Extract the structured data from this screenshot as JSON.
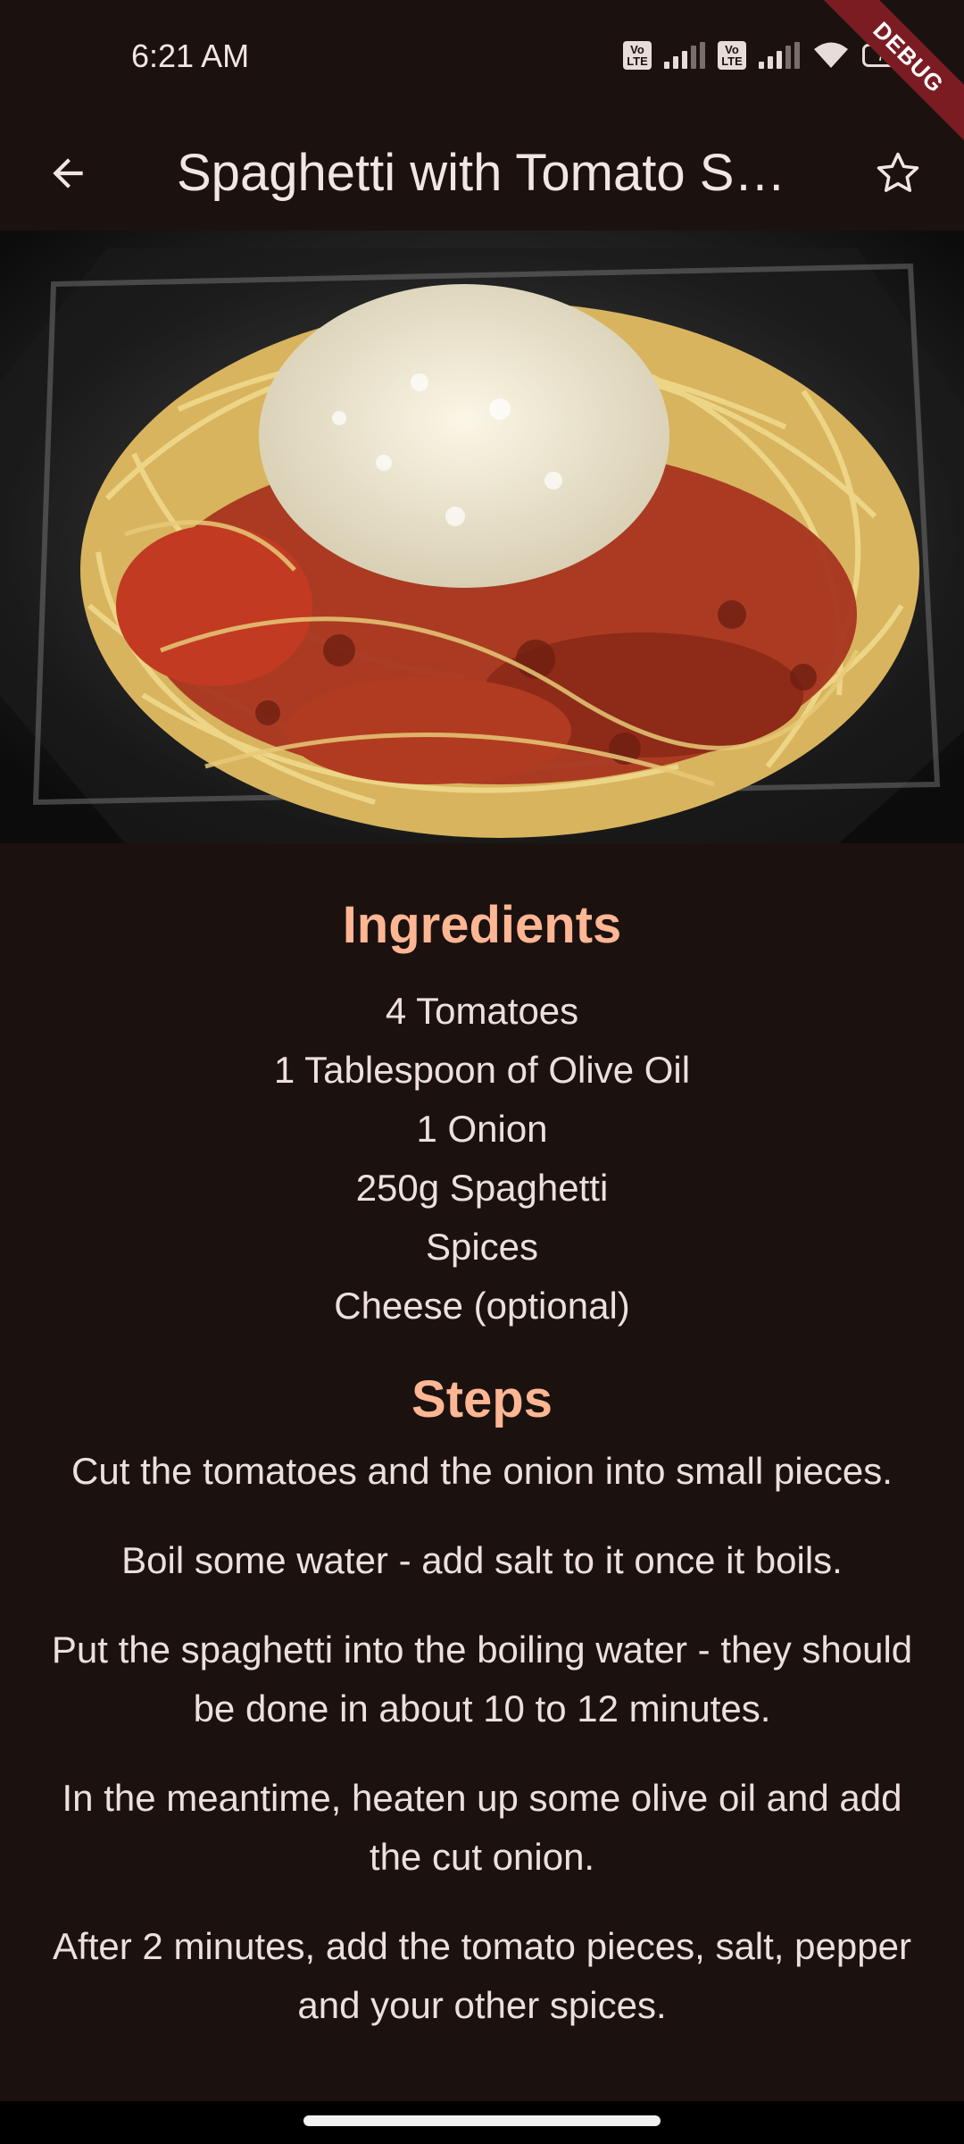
{
  "status_bar": {
    "time": "6:21 AM",
    "volte1": "Vo LTE",
    "volte2": "Vo LTE",
    "battery": "72"
  },
  "debug_banner": "DEBUG",
  "app_bar": {
    "title": "Spaghetti with Tomato Sauce",
    "back_icon": "arrow-back-icon",
    "favorite_icon": "star-outline-icon"
  },
  "hero_image": {
    "description": "spaghetti with tomato sauce and grated cheese"
  },
  "ingredients": {
    "title": "Ingredients",
    "items": [
      "4 Tomatoes",
      "1 Tablespoon of Olive Oil",
      "1 Onion",
      "250g Spaghetti",
      "Spices",
      "Cheese (optional)"
    ]
  },
  "steps": {
    "title": "Steps",
    "items": [
      "Cut the tomatoes and the onion into small pieces.",
      "Boil some water - add salt to it once it boils.",
      "Put the spaghetti into the boiling water - they should be done in about 10 to 12 minutes.",
      "In the meantime, heaten up some olive oil and add the cut onion.",
      "After 2 minutes, add the tomato pieces, salt, pepper and your other spices."
    ]
  },
  "colors": {
    "background": "#1b1210",
    "accent": "#ffb693",
    "text": "#ede0dc"
  }
}
